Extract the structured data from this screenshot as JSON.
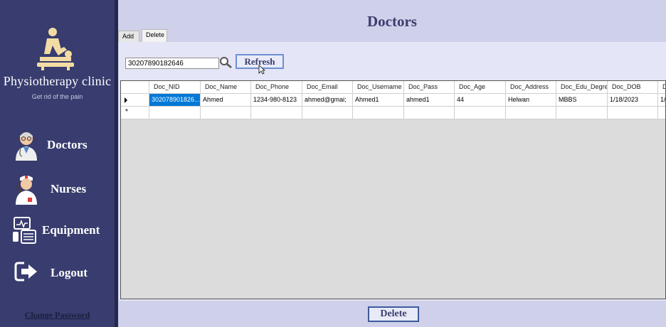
{
  "sidebar": {
    "clinic_name": "Physiotherapy clinic",
    "tagline": "Get rid of the pain",
    "nav": [
      {
        "label": "Doctors",
        "icon": "doctor-icon"
      },
      {
        "label": "Nurses",
        "icon": "nurse-icon"
      },
      {
        "label": "Equipment",
        "icon": "equipment-icon"
      },
      {
        "label": "Logout",
        "icon": "logout-icon"
      }
    ],
    "change_password": "Change Password"
  },
  "main": {
    "title": "Doctors",
    "tabs": [
      "Add",
      "Delete"
    ],
    "active_tab": "Delete",
    "search_value": "30207890182646",
    "refresh_label": "Refresh",
    "delete_label": "Delete"
  },
  "grid": {
    "columns": [
      "Doc_NID",
      "Doc_Name",
      "Doc_Phone",
      "Doc_Email",
      "Doc_Username",
      "Doc_Pass",
      "Doc_Age",
      "Doc_Address",
      "Doc_Edu_Degre",
      "Doc_DOB",
      "D"
    ],
    "rows": [
      [
        "302078901826...",
        "Ahmed",
        "1234-980-8123",
        "ahmed@gmai;",
        "Ahmed1",
        "ahmed1",
        "44",
        "Helwan",
        "MBBS",
        "1/18/2023",
        "1/"
      ]
    ]
  },
  "colors": {
    "sidebar_bg": "#383c6e",
    "main_bg": "#cfd0ea",
    "selection": "#0078d7",
    "button_border": "#6d8fd3"
  }
}
